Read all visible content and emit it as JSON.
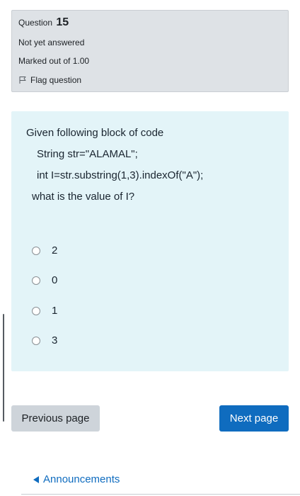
{
  "question": {
    "label": "Question",
    "number": "15",
    "status": "Not yet answered",
    "marks": "Marked out of 1.00",
    "flag_label": "Flag question"
  },
  "formulation": {
    "lines": [
      "Given following block of code",
      "String str=\"ALAMAL\";",
      "int I=str.substring(1,3).indexOf(\"A\");",
      "what is the value of I?"
    ],
    "options": [
      "2",
      "0",
      "1",
      "3"
    ]
  },
  "navigation": {
    "prev_label": "Previous page",
    "next_label": "Next page",
    "announcements_label": "Announcements"
  },
  "colors": {
    "info_bg": "#dee2e6",
    "formulation_bg": "#e3f4f8",
    "primary": "#0f6cbf",
    "secondary": "#ced4da"
  }
}
